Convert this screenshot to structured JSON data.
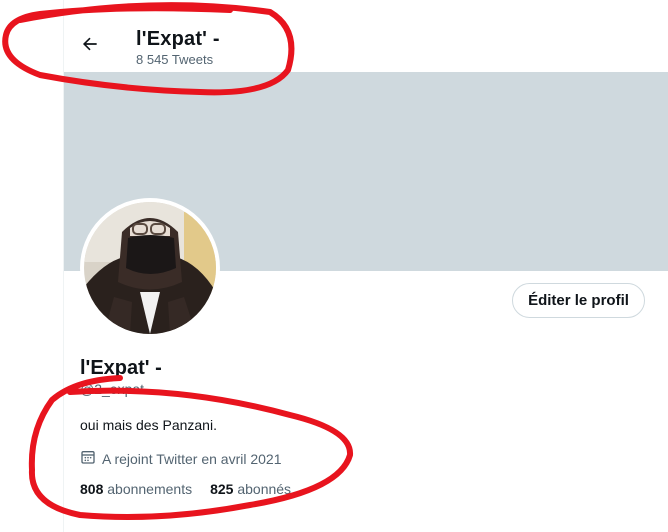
{
  "header": {
    "title": "l'Expat' -",
    "tweet_count": "8 545 Tweets",
    "back_icon": "arrow-left-icon"
  },
  "banner": {
    "color": "#cfd9de"
  },
  "profile": {
    "edit_button_label": "Éditer le profil",
    "name": "l'Expat' -",
    "handle": "@2_expat",
    "bio": "oui mais des Panzani.",
    "joined_icon": "calendar-icon",
    "joined": "A rejoint Twitter en avril 2021",
    "following_count": "808",
    "following_label": "abonnements",
    "followers_count": "825",
    "followers_label": "abonnés"
  },
  "annotations": {
    "color": "#e8141e"
  },
  "colors": {
    "text": "#0f1419",
    "secondary": "#536471",
    "border": "#cfd9de"
  }
}
